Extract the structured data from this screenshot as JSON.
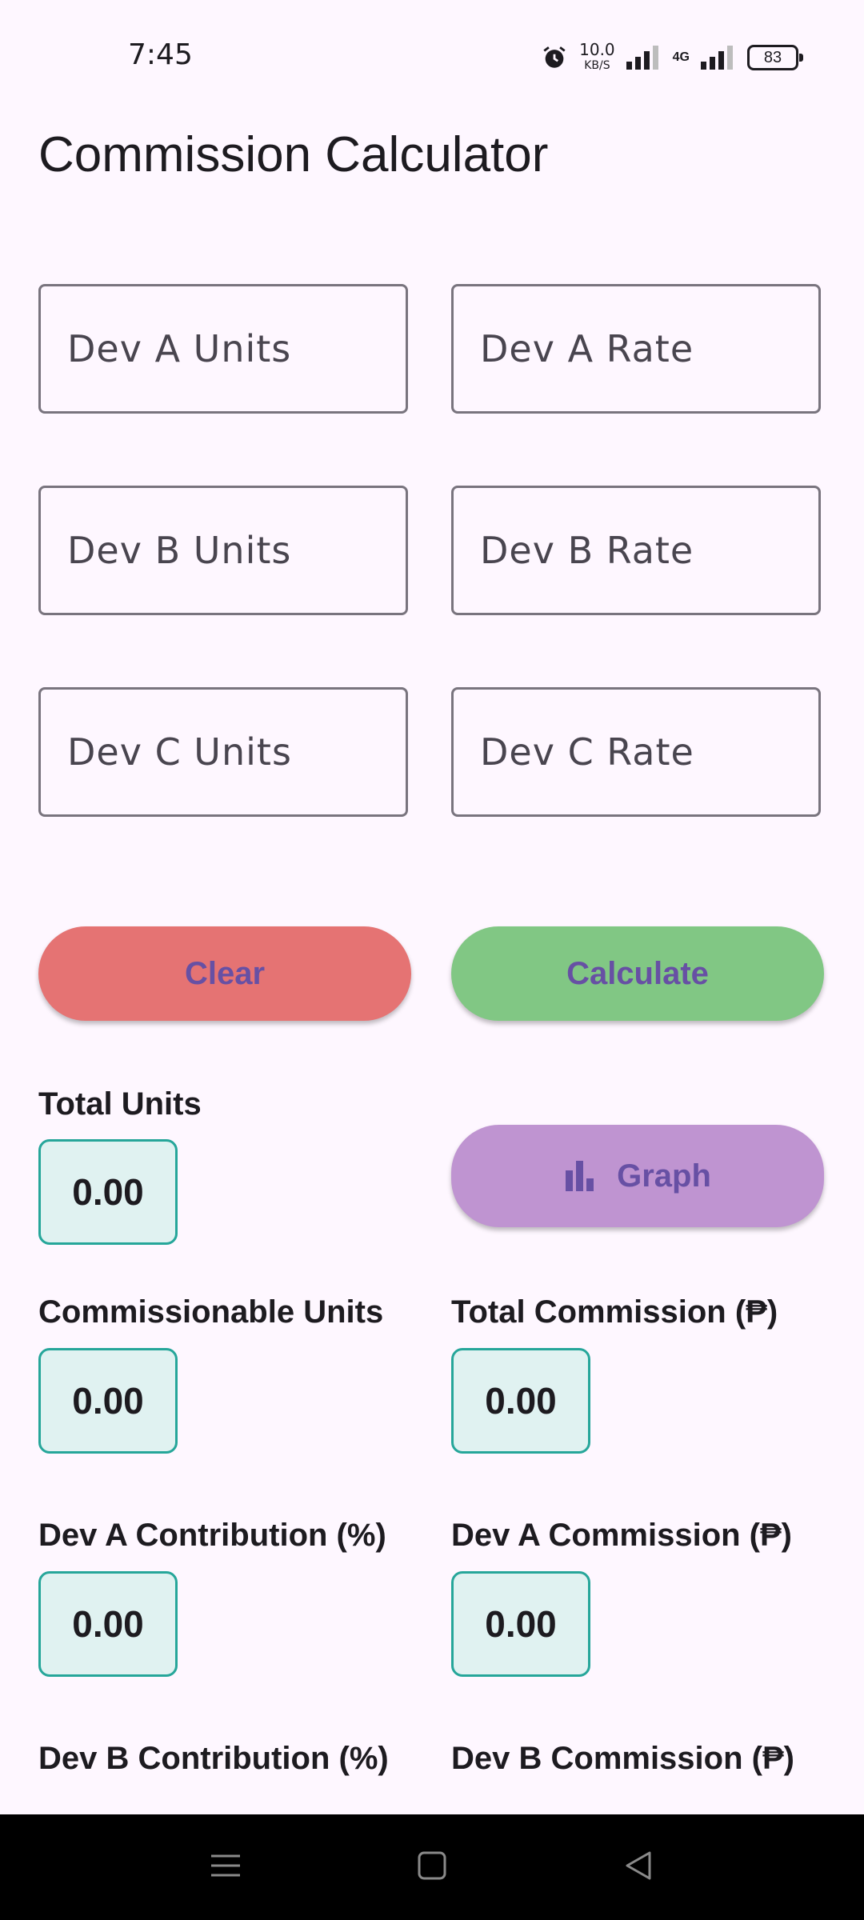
{
  "status": {
    "time": "7:45",
    "speed_value": "10.0",
    "speed_unit": "KB/S",
    "network": "4G",
    "battery": "83"
  },
  "title": "Commission Calculator",
  "inputs": {
    "dev_a_units": "Dev A Units",
    "dev_a_rate": "Dev A Rate",
    "dev_b_units": "Dev B Units",
    "dev_b_rate": "Dev B Rate",
    "dev_c_units": "Dev C Units",
    "dev_c_rate": "Dev C Rate"
  },
  "buttons": {
    "clear": "Clear",
    "calculate": "Calculate",
    "graph": "Graph"
  },
  "results": {
    "total_units": {
      "label": "Total Units",
      "value": "0.00"
    },
    "commissionable_units": {
      "label": "Commissionable Units",
      "value": "0.00"
    },
    "total_commission": {
      "label": "Total Commission (₱)",
      "value": "0.00"
    },
    "dev_a_contribution": {
      "label": "Dev A Contribution (%)",
      "value": "0.00"
    },
    "dev_a_commission": {
      "label": "Dev A Commission (₱)",
      "value": "0.00"
    },
    "dev_b_contribution": {
      "label": "Dev B Contribution (%)"
    },
    "dev_b_commission": {
      "label": "Dev B Commission (₱)"
    }
  },
  "colors": {
    "clear": "#E57373",
    "calculate": "#81C784",
    "graph": "#BF94D1",
    "value_border": "#26A69A"
  }
}
